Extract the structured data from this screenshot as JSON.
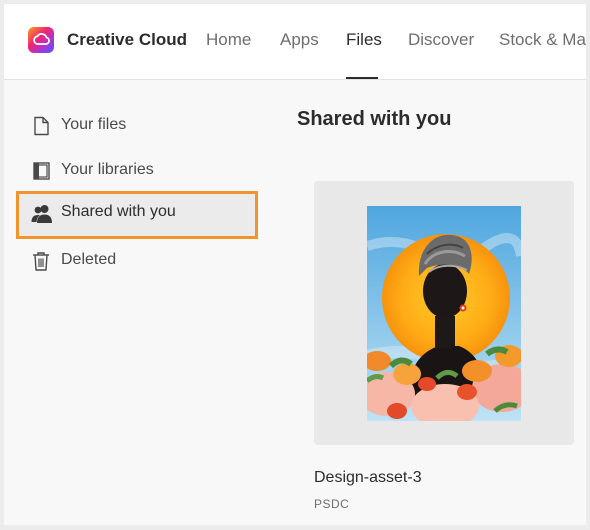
{
  "header": {
    "app_title": "Creative Cloud",
    "nav": [
      {
        "label": "Home"
      },
      {
        "label": "Apps"
      },
      {
        "label": "Files"
      },
      {
        "label": "Discover"
      },
      {
        "label": "Stock & Mar"
      }
    ],
    "active_nav": "Files"
  },
  "sidebar": {
    "items": [
      {
        "label": "Your files",
        "icon": "file-icon"
      },
      {
        "label": "Your libraries",
        "icon": "libraries-icon"
      },
      {
        "label": "Shared with you",
        "icon": "shared-users-icon"
      },
      {
        "label": "Deleted",
        "icon": "trash-icon"
      }
    ],
    "selected": "Shared with you"
  },
  "main": {
    "title": "Shared with you",
    "files": [
      {
        "name": "Design-asset-3",
        "type": "PSDC",
        "thumbnail": "portrait-illustration"
      }
    ]
  },
  "colors": {
    "highlight_border": "#f0952e",
    "text_primary": "#2c2c2c",
    "text_secondary": "#6e6e6e"
  }
}
